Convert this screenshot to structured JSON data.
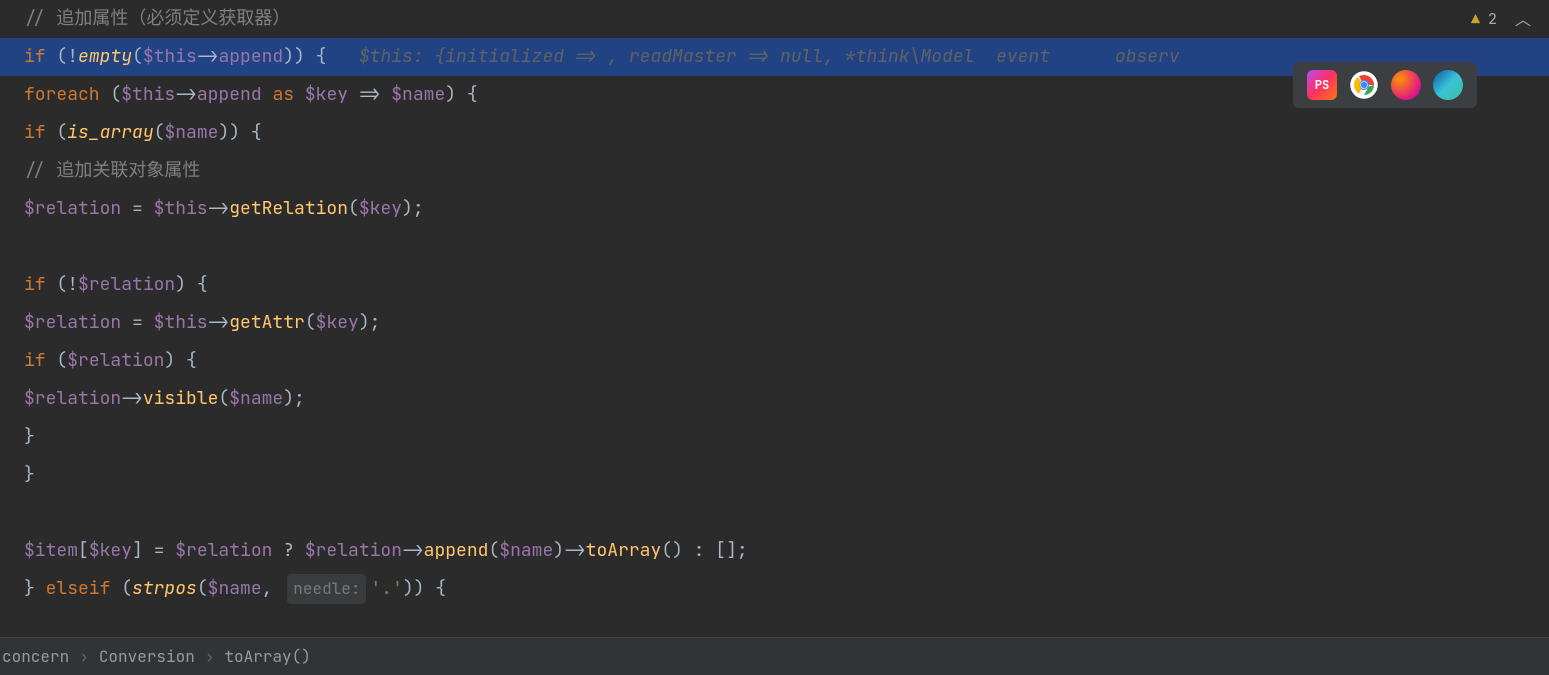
{
  "problems": {
    "warning_count": "2"
  },
  "code": {
    "comment1": "// 追加属性（必须定义获取器）",
    "l2": {
      "if": "if ",
      "open": "(!",
      "empty": "empty",
      "p1": "(",
      "this": "$this",
      "arrow": "->",
      "append": "append",
      "close": ")) {   ",
      "hint": "$this: {initialized => , readMaster => null, *think\\Model",
      "hint2": "event",
      "hint3": "observ"
    },
    "l3": {
      "foreach": "foreach ",
      "open": "(",
      "this": "$this",
      "arrow": "->",
      "append": "append",
      "as": " as ",
      "key": "$key",
      "fat": " => ",
      "name": "$name",
      "close": ") {"
    },
    "l4": {
      "if": "if ",
      "open": "(",
      "is_array": "is_array",
      "p1": "(",
      "name": "$name",
      "close": ")) {"
    },
    "comment2": "// 追加关联对象属性",
    "l6": {
      "relation": "$relation",
      "eq": " = ",
      "this": "$this",
      "arrow": "->",
      "method": "getRelation",
      "p1": "(",
      "key": "$key",
      "close": ");"
    },
    "l8": {
      "if": "if ",
      "open": "(!",
      "relation": "$relation",
      "close": ") {"
    },
    "l9": {
      "relation": "$relation",
      "eq": " = ",
      "this": "$this",
      "arrow": "->",
      "method": "getAttr",
      "p1": "(",
      "key": "$key",
      "close": ");"
    },
    "l10": {
      "if": "if ",
      "open": "(",
      "relation": "$relation",
      "close": ") {"
    },
    "l11": {
      "relation": "$relation",
      "arrow": "->",
      "method": "visible",
      "p1": "(",
      "name": "$name",
      "close": ");"
    },
    "l12": "}",
    "l13": "}",
    "l15": {
      "item": "$item",
      "b1": "[",
      "key": "$key",
      "b2": "] = ",
      "relation": "$relation",
      "q": " ? ",
      "relation2": "$relation",
      "arrow": "->",
      "append": "append",
      "p1": "(",
      "name": "$name",
      "p2": ")->",
      "toArray": "toArray",
      "p3": "() : [];"
    },
    "l16": {
      "close": "} ",
      "elseif": "elseif ",
      "open": "(",
      "strpos": "strpos",
      "p1": "(",
      "name": "$name",
      "comma": ", ",
      "hint": "needle:",
      "str": "'.'",
      "close2": ")) {"
    }
  },
  "breadcrumb": {
    "item1": "concern",
    "item2": "Conversion",
    "item3": "toArray()",
    "sep": "›"
  },
  "apps": {
    "phpstorm": "PhpStorm",
    "chrome": "Chrome",
    "firefox": "Firefox",
    "edge": "Edge"
  }
}
